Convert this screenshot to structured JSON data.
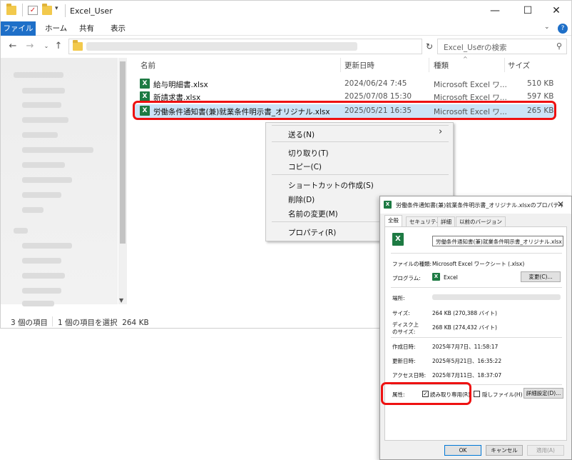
{
  "window": {
    "title": "Excel_User"
  },
  "ribbon": {
    "tabs": [
      "ファイル",
      "ホーム",
      "共有",
      "表示"
    ]
  },
  "search": {
    "placeholder": "Excel_Userの検索"
  },
  "columns": {
    "name": "名前",
    "date": "更新日時",
    "type": "種類",
    "size": "サイズ"
  },
  "files": [
    {
      "name": "給与明細書.xlsx",
      "date": "2024/06/24 7:45",
      "type": "Microsoft Excel ワ...",
      "size": "510 KB"
    },
    {
      "name": "新請求書.xlsx",
      "date": "2025/07/08 15:30",
      "type": "Microsoft Excel ワ...",
      "size": "597 KB"
    },
    {
      "name": "労働条件通知書(兼)就業条件明示書_オリジナル.xlsx",
      "date": "2025/05/21 16:35",
      "type": "Microsoft Excel ワ...",
      "size": "265 KB"
    }
  ],
  "status": {
    "count": "3 個の項目",
    "selection": "1 個の項目を選択  264 KB"
  },
  "context_menu": {
    "send_to": "送る(N)",
    "cut": "切り取り(T)",
    "copy": "コピー(C)",
    "create_shortcut": "ショートカットの作成(S)",
    "delete": "削除(D)",
    "rename": "名前の変更(M)",
    "properties": "プロパティ(R)"
  },
  "dialog": {
    "title": "労働条件通知書(兼)就業条件明示書_オリジナル.xlsxのプロパティ",
    "tabs": [
      "全般",
      "セキュリティ",
      "詳細",
      "以前のバージョン"
    ],
    "filename": "労働条件通知書(兼)就業条件明示書_オリジナル.xlsx",
    "file_type_label": "ファイルの種類:",
    "file_type": "Microsoft Excel ワークシート (.xlsx)",
    "program_label": "プログラム:",
    "program": "Excel",
    "change_button": "変更(C)...",
    "location_label": "場所:",
    "size_label": "サイズ:",
    "size": "264 KB (270,388 バイト)",
    "disk_size_label_1": "ディスク上",
    "disk_size_label_2": "のサイズ:",
    "disk_size": "268 KB (274,432 バイト)",
    "created_label": "作成日時:",
    "created": "2025年7月7日、11:58:17",
    "modified_label": "更新日時:",
    "modified": "2025年5月21日、16:35:22",
    "accessed_label": "アクセス日時:",
    "accessed": "2025年7月11日、18:37:07",
    "attributes_label": "属性:",
    "readonly": "読み取り専用(R)",
    "hidden": "隠しファイル(H)",
    "advanced_button": "詳細設定(D)...",
    "ok": "OK",
    "cancel": "キャンセル",
    "apply": "適用(A)"
  },
  "colors": {
    "accent": "#1e6fc8",
    "highlight_red": "#e11111",
    "selection": "#cce4f7",
    "excel_green": "#1d7a43"
  }
}
